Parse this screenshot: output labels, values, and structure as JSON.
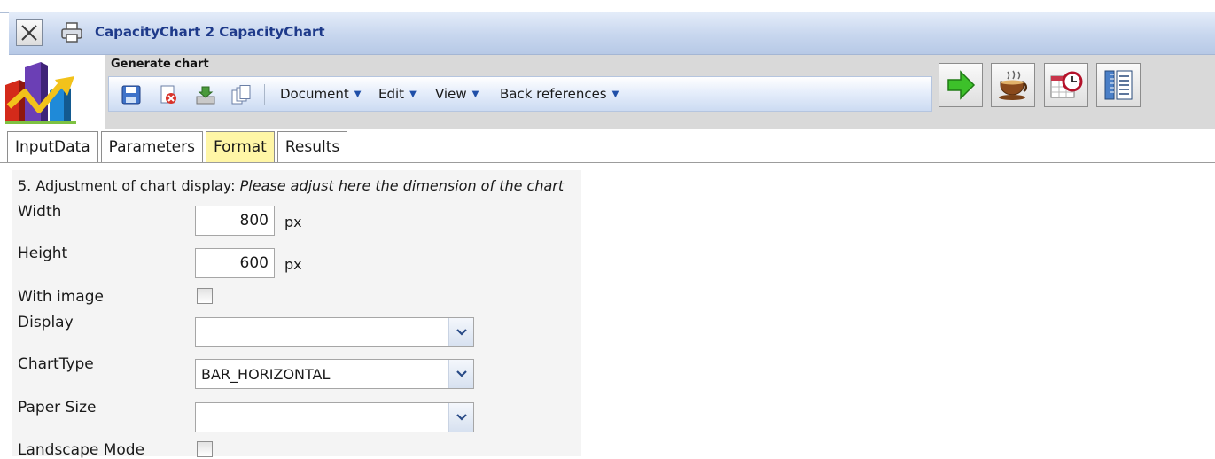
{
  "window": {
    "title": "CapacityChart 2 CapacityChart",
    "close_icon": "close-icon",
    "print_icon": "printer-icon"
  },
  "toolbar": {
    "heading": "Generate chart",
    "logo_icon": "chart-logo-icon",
    "icons": [
      "save-icon",
      "delete-icon",
      "import-icon",
      "copy-icon"
    ],
    "menus": [
      "Document",
      "Edit",
      "View",
      "Back references"
    ],
    "actions": [
      "run-arrow-icon",
      "coffee-cup-icon",
      "calendar-clock-icon",
      "ruler-chart-icon"
    ]
  },
  "tabs": [
    {
      "label": "InputData",
      "active": false
    },
    {
      "label": "Parameters",
      "active": false
    },
    {
      "label": "Format",
      "active": true
    },
    {
      "label": "Results",
      "active": false
    }
  ],
  "form": {
    "section_number": "5. Adjustment of chart display:",
    "section_hint": "Please adjust here the dimension of the chart",
    "width": {
      "label": "Width",
      "value": "800",
      "unit": "px"
    },
    "height": {
      "label": "Height",
      "value": "600",
      "unit": "px"
    },
    "with_image": {
      "label": "With image",
      "checked": false
    },
    "display": {
      "label": "Display",
      "value": ""
    },
    "chart_type": {
      "label": "ChartType",
      "value": "BAR_HORIZONTAL"
    },
    "paper_size": {
      "label": "Paper Size",
      "value": ""
    },
    "landscape": {
      "label": "Landscape Mode",
      "checked": false
    }
  },
  "colors": {
    "title_text": "#1e3a8a",
    "active_tab": "#fff6a6",
    "toolbar_bg": "#d9d9d9"
  }
}
